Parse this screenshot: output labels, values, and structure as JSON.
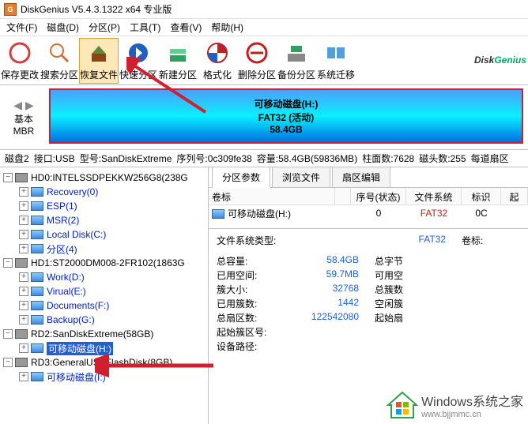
{
  "title": "DiskGenius V5.4.3.1322 x64 专业版",
  "menu": [
    "文件(F)",
    "磁盘(D)",
    "分区(P)",
    "工具(T)",
    "查看(V)",
    "帮助(H)"
  ],
  "toolbar": [
    {
      "label": "保存更改",
      "icon": "save"
    },
    {
      "label": "搜索分区",
      "icon": "search"
    },
    {
      "label": "恢复文件",
      "icon": "recover",
      "hover": true
    },
    {
      "label": "快速分区",
      "icon": "quick"
    },
    {
      "label": "新建分区",
      "icon": "new"
    },
    {
      "label": "格式化",
      "icon": "format"
    },
    {
      "label": "删除分区",
      "icon": "delete"
    },
    {
      "label": "备份分区",
      "icon": "backup"
    },
    {
      "label": "系统迁移",
      "icon": "migrate"
    }
  ],
  "brand": {
    "a": "Disk",
    "b": "Genius"
  },
  "diskbar": {
    "line1": "可移动磁盘(H:)",
    "line2": "FAT32 (活动)",
    "line3": "58.4GB"
  },
  "diskmap_left": {
    "l1": "基本",
    "l2": "MBR"
  },
  "status": {
    "a": "磁盘2",
    "b": "接口:USB",
    "c": "型号:SanDiskExtreme",
    "d": "序列号:0c309fe38",
    "e": "容量:58.4GB(59836MB)",
    "f": "柱面数:7628",
    "g": "磁头数:255",
    "h": "每道扇区"
  },
  "tree": {
    "d0": {
      "name": "HD0:INTELSSDPEKKW256G8(238G",
      "parts": [
        "Recovery(0)",
        "ESP(1)",
        "MSR(2)",
        "Local Disk(C:)",
        "分区(4)"
      ]
    },
    "d1": {
      "name": "HD1:ST2000DM008-2FR102(1863G",
      "parts": [
        "Work(D:)",
        "Virual(E:)",
        "Documents(F:)",
        "Backup(G:)"
      ]
    },
    "d2": {
      "name": "RD2:SanDiskExtreme(58GB)",
      "parts": [
        "可移动磁盘(H:)"
      ]
    },
    "d3": {
      "name": "RD3:GeneralUSBFlashDisk(8GB)",
      "parts": [
        "可移动磁盘(I:)"
      ]
    }
  },
  "tabs": [
    "分区参数",
    "浏览文件",
    "扇区编辑"
  ],
  "grid": {
    "headers": [
      "卷标",
      "",
      "序号(状态)",
      "文件系统",
      "标识",
      "起"
    ],
    "row": {
      "name": "可移动磁盘(H:)",
      "seq": "0",
      "fs": "FAT32",
      "flag": "0C"
    }
  },
  "details": {
    "fstype_k": "文件系统类型:",
    "fstype_v": "FAT32",
    "rk1": "卷标:",
    "rows": [
      {
        "k": "总容量:",
        "v": "58.4GB",
        "k2": "总字节"
      },
      {
        "k": "已用空间:",
        "v": "59.7MB",
        "k2": "可用空"
      },
      {
        "k": "簇大小:",
        "v": "32768",
        "k2": "总簇数"
      },
      {
        "k": "已用簇数:",
        "v": "1442",
        "k2": "空闲簇"
      },
      {
        "k": "总扇区数:",
        "v": "122542080",
        "k2": "起始扇"
      },
      {
        "k": "起始簇区号:",
        "v": "",
        "k2": ""
      },
      {
        "k": "设备路径:",
        "v": "",
        "k2": ""
      }
    ]
  },
  "watermark": {
    "t1": "Windows系统之家",
    "t2": "www.bjjmmc.cn"
  }
}
